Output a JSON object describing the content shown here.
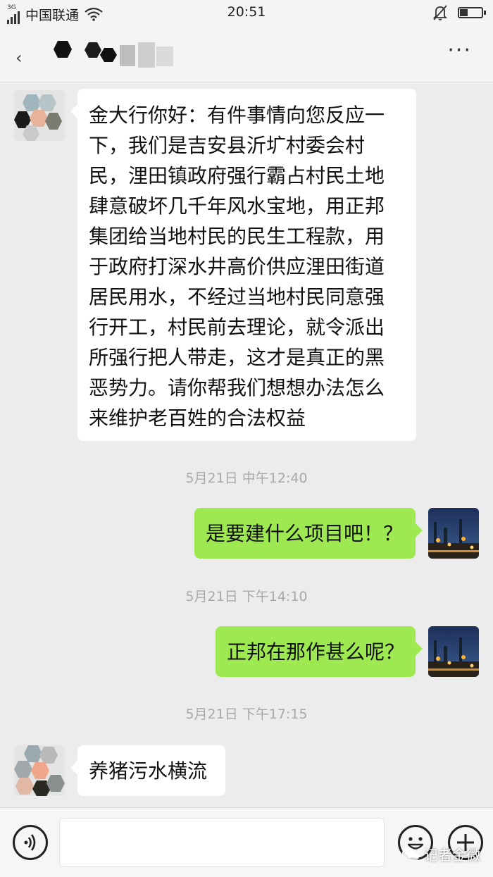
{
  "status_bar": {
    "network": "3G",
    "carrier": "中国联通",
    "time": "20:51",
    "battery_level": 0.35
  },
  "header": {
    "title": "",
    "more_label": "···"
  },
  "messages": [
    {
      "direction": "in",
      "text": "金大行你好：有件事情向您反应一下，我们是吉安县沂圹村委会村民，浬田镇政府强行霸占村民土地肆意破坏几千年风水宝地，用正邦集团给当地村民的民生工程款，用于政府打深水井高价供应浬田街道居民用水，不经过当地村民同意强行开工，村民前去理论，就令派出所强行把人带走，这才是真正的黑恶势力。请你帮我们想想办法怎么来维护老百姓的合法权益"
    },
    {
      "direction": "time",
      "text": "5月21日 中午12:40"
    },
    {
      "direction": "out",
      "text": "是要建什么项目吧！？"
    },
    {
      "direction": "time",
      "text": "5月21日 下午14:10"
    },
    {
      "direction": "out",
      "text": "正邦在那作甚么呢？"
    },
    {
      "direction": "time",
      "text": "5月21日 下午17:15"
    },
    {
      "direction": "in",
      "text": "养猪污水横流"
    }
  ],
  "input_bar": {
    "voice_icon": "voice-icon",
    "emoji_icon": "emoji-icon",
    "plus_icon": "plus-icon",
    "watermark": "记者金微"
  },
  "colors": {
    "outgoing_bubble": "#9ee952",
    "incoming_bubble": "#ffffff",
    "background": "#ececec"
  }
}
